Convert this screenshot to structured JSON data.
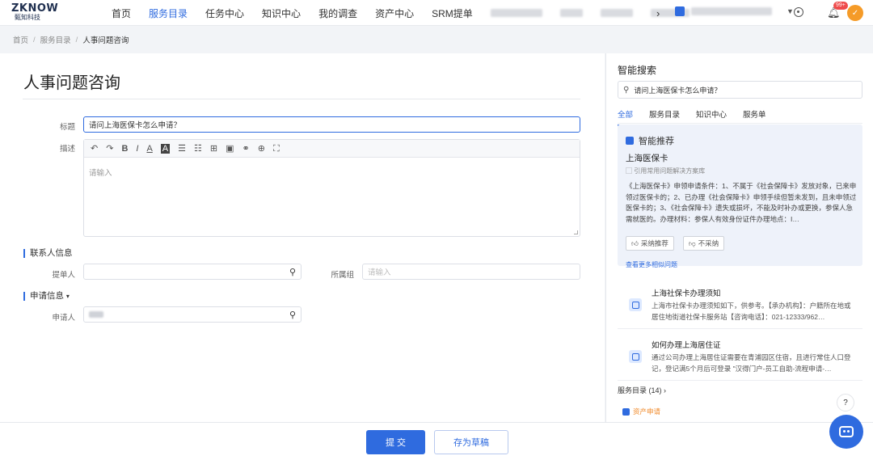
{
  "brand": {
    "name": "ZKNOW",
    "sub": "甄知科技"
  },
  "nav": {
    "items": [
      "首页",
      "服务目录",
      "任务中心",
      "知识中心",
      "我的调查",
      "资产中心",
      "SRM提单"
    ],
    "active_index": 1,
    "more": "›"
  },
  "header": {
    "notification_count": "99+",
    "avatar_initial": "✓"
  },
  "breadcrumb": {
    "items": [
      "首页",
      "服务目录",
      "人事问题咨询"
    ],
    "separator": "/"
  },
  "form": {
    "page_title": "人事问题咨询",
    "title_label": "标题",
    "title_value": "请问上海医保卡怎么申请？",
    "desc_label": "描述",
    "desc_placeholder": "请输入",
    "contact_section": "联系人信息",
    "submitter_label": "提单人",
    "group_label": "所属组",
    "group_placeholder": "请输入",
    "apply_section": "申请信息",
    "applicant_label": "申请人"
  },
  "toolbar": {
    "undo": "↶",
    "redo": "↷",
    "bold": "B",
    "italic": "I",
    "font_color": "A",
    "bg_color": "A",
    "bullet_list": "☰",
    "ordered_list": "☷",
    "table": "⊞",
    "image": "▣",
    "link": "⚭",
    "embed": "⊕",
    "fullscreen": "⛶"
  },
  "footer": {
    "submit": "提 交",
    "draft": "存为草稿"
  },
  "side": {
    "title": "智能搜索",
    "search_value": "请问上海医保卡怎么申请？",
    "tabs": [
      "全部",
      "服务目录",
      "知识中心",
      "服务单"
    ],
    "active_tab": 0,
    "ai": {
      "heading": "智能推荐",
      "subtitle": "上海医保卡",
      "ref": "引用常用问题解决方案库",
      "body": "《上海医保卡》申领申请条件：1、不属于《社会保障卡》发放对象，已来申领过医保卡的；2、已办理《社会保障卡》申领手续但暂未发到，且未申领过医保卡的；3、《社会保障卡》遗失或损坏，不能及时补办或更换，参保人急需就医的。办理材料：参保人有效身份证件办理地点：I…",
      "adopt": "采纳推荐",
      "reject": "不采纳",
      "more": "查看更多相似问题"
    },
    "results": [
      {
        "title": "上海社保卡办理须知",
        "desc": "上海市社保卡办理须知如下，供参考。【承办机构】：户籍所在地或居住地街道社保卡服务站【咨询电话】：021-12333/962…"
      },
      {
        "title": "如何办理上海居住证",
        "desc": "通过公司办理上海居住证需要在青浦园区住宿，且进行常住人口登记，登记满5个月后可登录 \"汉得门户-员工自助-流程申请-…"
      }
    ],
    "service_link": "服务目录 (14) ›",
    "service_item": "资产申请"
  },
  "colors": {
    "accent": "#2f6bdf",
    "badge": "#ef4b4b",
    "avatar": "#f59b28"
  }
}
